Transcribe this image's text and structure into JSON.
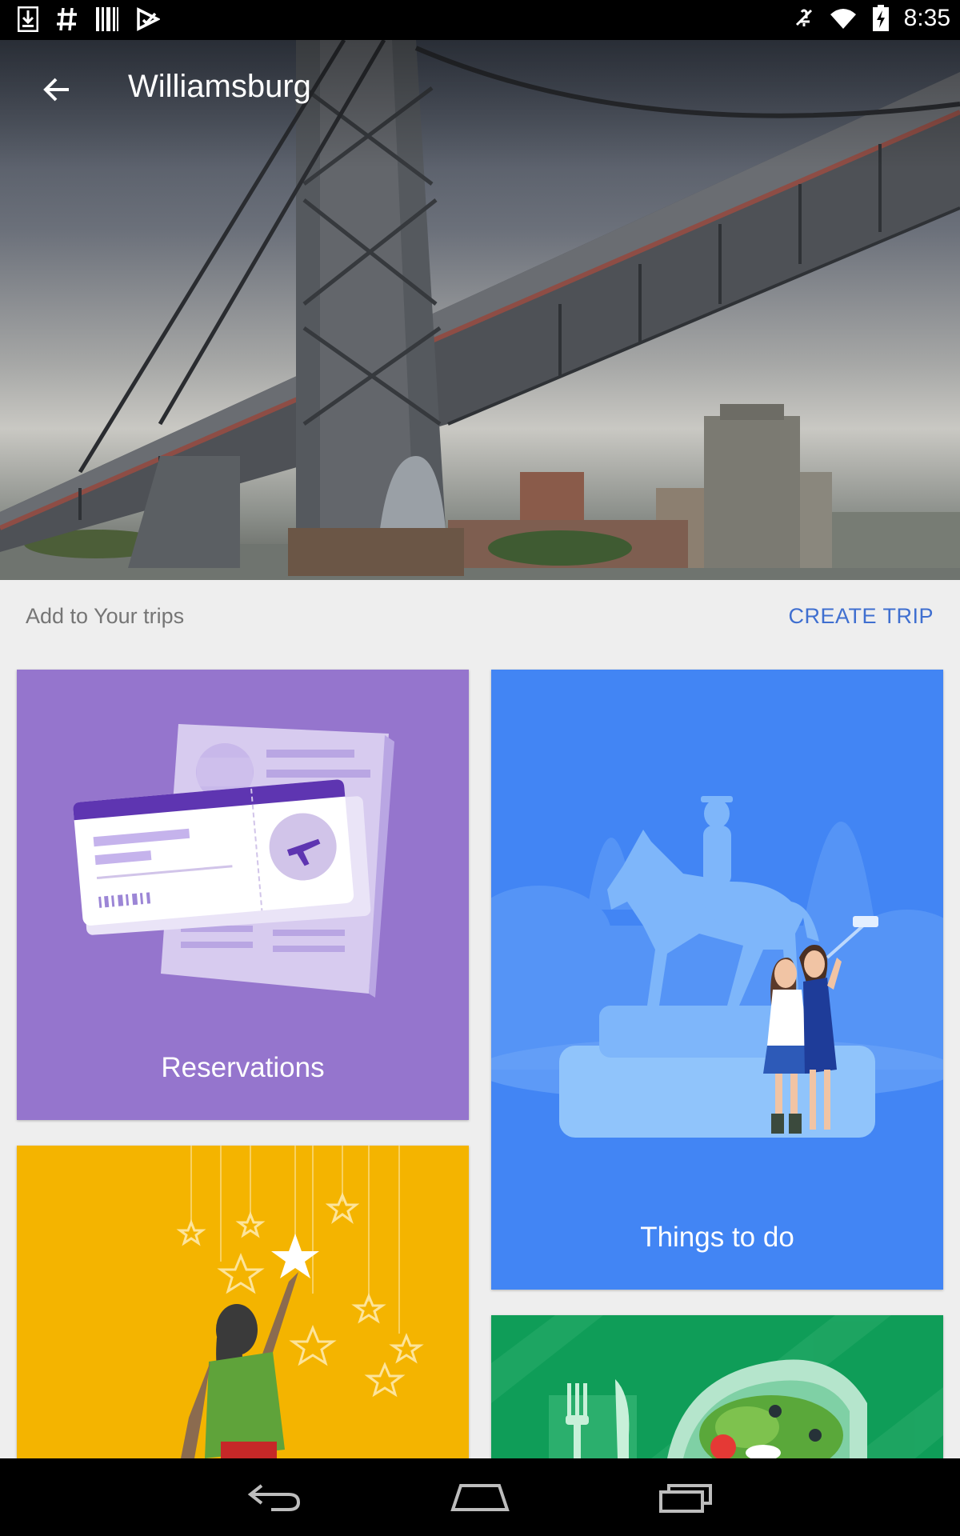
{
  "status_bar": {
    "time": "8:35",
    "left_icons": [
      "download-icon",
      "hash-icon",
      "barcode-icon",
      "play-store-icon"
    ],
    "right_icons": [
      "mute-icon",
      "wifi-icon",
      "battery-charging-icon"
    ]
  },
  "header": {
    "title": "Williamsburg",
    "back_icon": "arrow-back-icon"
  },
  "trips": {
    "label": "Add to Your trips",
    "create_label": "CREATE TRIP"
  },
  "cards": [
    {
      "label": "Reservations",
      "color": "#9575cd"
    },
    {
      "label": "Things to do",
      "color": "#4285f4"
    },
    {
      "label": "",
      "color": "#f4b400"
    },
    {
      "label": "",
      "color": "#0f9d58"
    }
  ],
  "nav_bar": {
    "icons": [
      "back-nav-icon",
      "home-nav-icon",
      "recents-nav-icon"
    ]
  },
  "colors": {
    "accent": "#3f6fd0",
    "background": "#eeeeee"
  }
}
